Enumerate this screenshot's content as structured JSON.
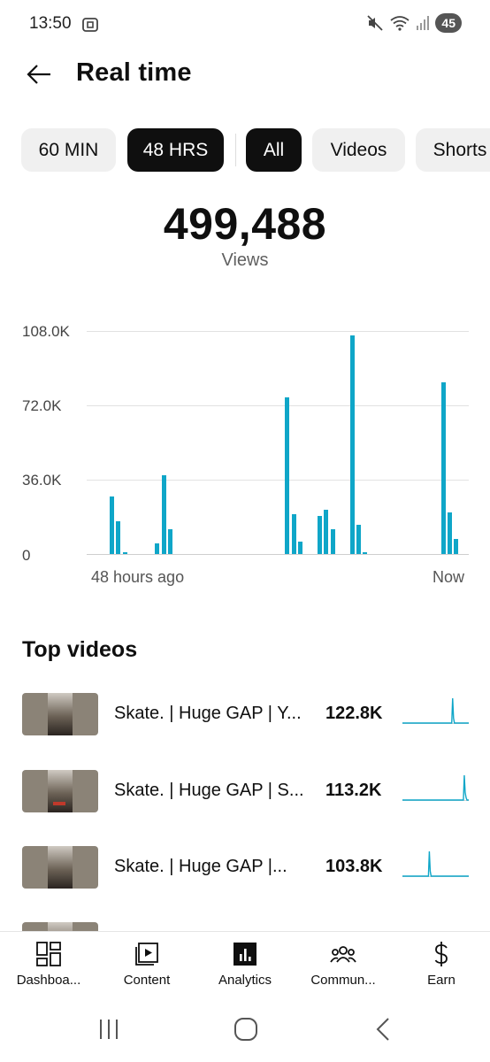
{
  "status_bar": {
    "time": "13:50",
    "battery": "45"
  },
  "header": {
    "title": "Real time"
  },
  "chips": [
    {
      "label": "60 MIN",
      "active": false
    },
    {
      "label": "48 HRS",
      "active": true
    },
    {
      "label": "All",
      "active": true
    },
    {
      "label": "Videos",
      "active": false
    },
    {
      "label": "Shorts",
      "active": false
    }
  ],
  "summary": {
    "total": "499,488",
    "label": "Views"
  },
  "chart_data": {
    "type": "bar",
    "ylim": [
      0,
      108000
    ],
    "y_ticks": [
      "108.0K",
      "72.0K",
      "36.0K",
      "0"
    ],
    "x_start_label": "48 hours ago",
    "x_end_label": "Now",
    "values": [
      0,
      0,
      0,
      28000,
      16000,
      1000,
      0,
      0,
      0,
      0,
      5000,
      38000,
      12000,
      0,
      0,
      0,
      0,
      0,
      0,
      0,
      0,
      0,
      0,
      0,
      0,
      0,
      0,
      0,
      0,
      0,
      76000,
      19500,
      6000,
      0,
      0,
      18500,
      21500,
      12000,
      0,
      0,
      106000,
      14000,
      500,
      0,
      0,
      0,
      0,
      0,
      0,
      0,
      0,
      0,
      0,
      0,
      83000,
      20000,
      7500,
      0
    ]
  },
  "top_videos": {
    "title": "Top videos",
    "items": [
      {
        "title": "Skate. | Huge GAP | Y...",
        "views": "122.8K",
        "spark": [
          0,
          0,
          0,
          0,
          0,
          0,
          0,
          0,
          0,
          0,
          0,
          0,
          0,
          0,
          0,
          0,
          0,
          0,
          0,
          0,
          0,
          0,
          0,
          0,
          0,
          0,
          0,
          0,
          0,
          0,
          0,
          0,
          0,
          0,
          0,
          0,
          0,
          0,
          0,
          0,
          0,
          0,
          0,
          0,
          0,
          0,
          0,
          0,
          0,
          0,
          0,
          0,
          0,
          0,
          0,
          0,
          1,
          0.2,
          0,
          0,
          0,
          0,
          0,
          0,
          0,
          0,
          0,
          0,
          0,
          0,
          0,
          0,
          0,
          0,
          0
        ]
      },
      {
        "title": "Skate. | Huge GAP | S...",
        "views": "113.2K",
        "spark": [
          0,
          0,
          0,
          0,
          0,
          0,
          0,
          0,
          0,
          0,
          0,
          0,
          0,
          0,
          0,
          0,
          0,
          0,
          0,
          0,
          0,
          0,
          0,
          0,
          0,
          0,
          0,
          0,
          0,
          0,
          0,
          0,
          0,
          0,
          0,
          0,
          0,
          0,
          0,
          0,
          0,
          0,
          0,
          0,
          0,
          0,
          0,
          0,
          0,
          0,
          0,
          0,
          0,
          0,
          0,
          0,
          0,
          0,
          0,
          0,
          0,
          0,
          0,
          0,
          0,
          0,
          0,
          0,
          0,
          1,
          0.3,
          0.1,
          0,
          0,
          0
        ]
      },
      {
        "title": "Skate. | Huge GAP |...",
        "views": "103.8K",
        "spark": [
          0,
          0,
          0,
          0,
          0,
          0,
          0,
          0,
          0,
          0,
          0,
          0,
          0,
          0,
          0,
          0,
          0,
          0,
          0,
          0,
          0,
          0,
          0,
          0,
          0,
          0,
          0,
          0,
          0,
          0,
          1,
          0.2,
          0,
          0,
          0,
          0,
          0,
          0,
          0,
          0,
          0,
          0,
          0,
          0,
          0,
          0,
          0,
          0,
          0,
          0,
          0,
          0,
          0,
          0,
          0,
          0,
          0,
          0,
          0,
          0,
          0,
          0,
          0,
          0,
          0,
          0,
          0,
          0,
          0,
          0,
          0,
          0,
          0,
          0,
          0
        ]
      }
    ]
  },
  "bottom_nav": [
    {
      "label": "Dashboa...",
      "icon": "dashboard-icon"
    },
    {
      "label": "Content",
      "icon": "content-icon"
    },
    {
      "label": "Analytics",
      "icon": "analytics-icon"
    },
    {
      "label": "Commun...",
      "icon": "community-icon"
    },
    {
      "label": "Earn",
      "icon": "earn-icon"
    }
  ],
  "colors": {
    "accent": "#0fa6c8",
    "chip_active": "#0f0f0f",
    "chip_inactive": "#f0f0f0"
  }
}
